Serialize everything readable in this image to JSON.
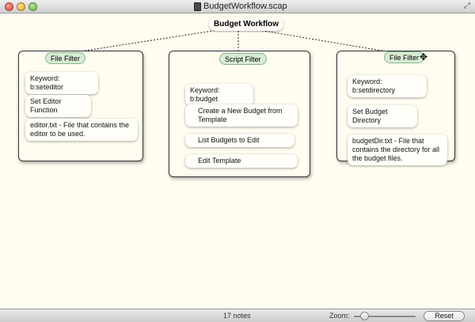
{
  "window": {
    "title": "BudgetWorkflow.scap"
  },
  "root": {
    "label": "Budget Workflow"
  },
  "groups": [
    {
      "title": "File Filter",
      "notes": [
        "Keyword:   b:seteditor",
        "Set Editor Function",
        "editor.txt - File that contains the editor to be used."
      ]
    },
    {
      "title": "Script Filter",
      "notes": [
        "Keyword:  b:budget",
        "Create a New Budget from Template",
        "List Budgets to Edit",
        "Edit Template"
      ]
    },
    {
      "title": "File Filter",
      "notes": [
        "Keyword: b:setdirectory",
        "Set Budget Directory",
        "budgetDir.txt - File that contains the directory for all the budget files."
      ]
    }
  ],
  "statusbar": {
    "note_count": "17 notes",
    "zoom_label": "Zoom:",
    "zoom_level": 0.12,
    "reset_label": "Reset"
  },
  "colors": {
    "canvas": "#fffdf0",
    "group_title_fill": "#d8ecd4",
    "group_title_border": "#8ab48a"
  }
}
